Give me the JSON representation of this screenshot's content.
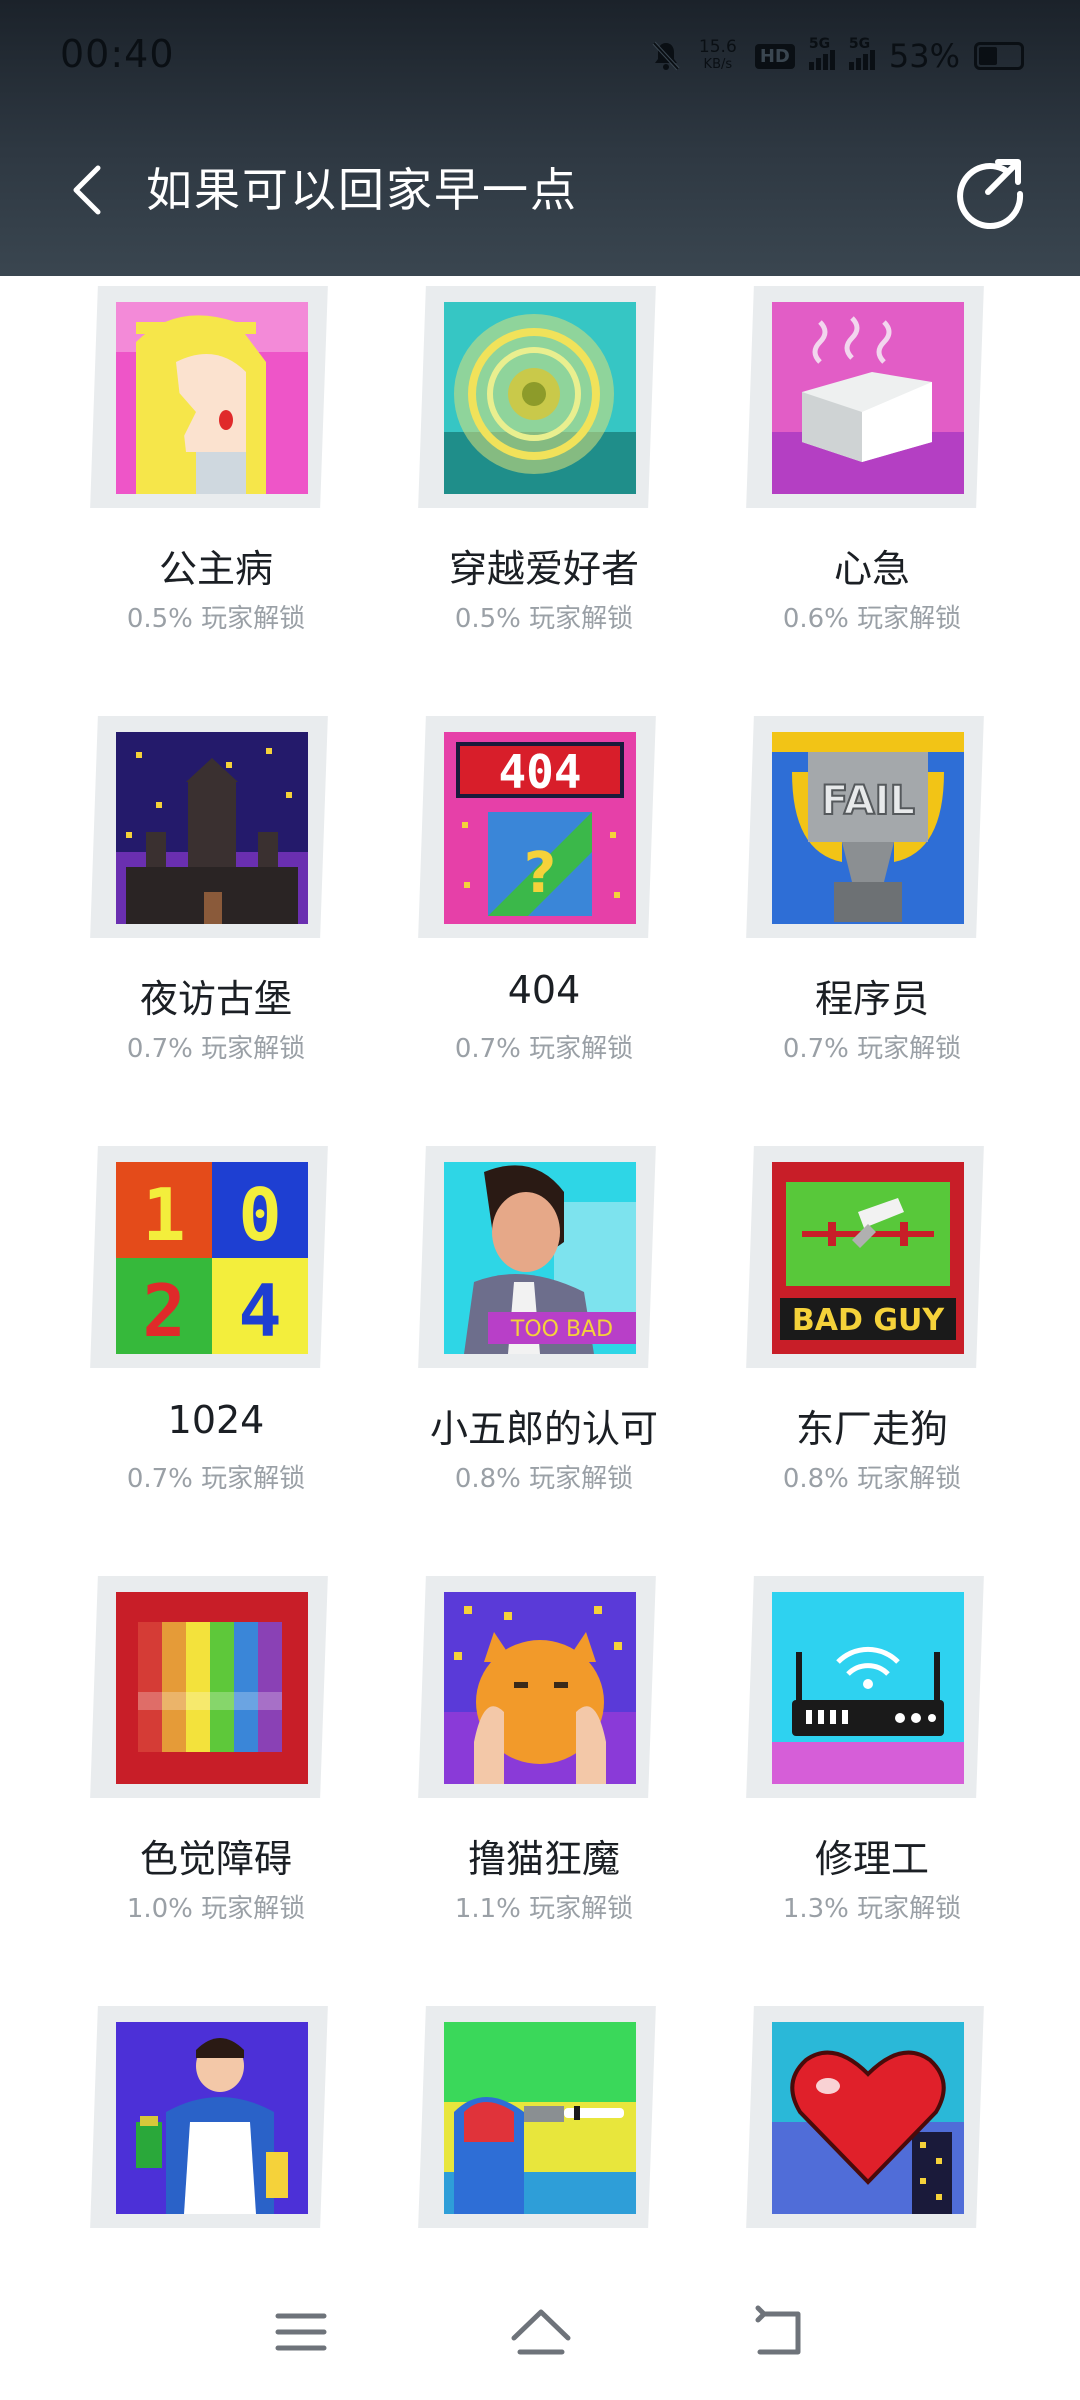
{
  "status": {
    "time": "00:40",
    "net_speed_value": "15.6",
    "net_speed_unit": "KB/s",
    "hd": "HD",
    "sim1": "5G",
    "sim2": "5G",
    "battery": "53%"
  },
  "header": {
    "title": "如果可以回家早一点",
    "back_icon": "chevron-left-icon",
    "share_icon": "share-icon"
  },
  "achievements": [
    {
      "name": "公主病",
      "rate": "0.5% 玩家解锁",
      "icon": "princess-icon"
    },
    {
      "name": "穿越爱好者",
      "rate": "0.5% 玩家解锁",
      "icon": "portal-icon"
    },
    {
      "name": "心急",
      "rate": "0.6% 玩家解锁",
      "icon": "tofu-icon"
    },
    {
      "name": "夜访古堡",
      "rate": "0.7% 玩家解锁",
      "icon": "castle-icon"
    },
    {
      "name": "404",
      "rate": "0.7% 玩家解锁",
      "icon": "404-icon",
      "tile_text": "404"
    },
    {
      "name": "程序员",
      "rate": "0.7% 玩家解锁",
      "icon": "fail-trophy-icon",
      "tile_text": "FAIL"
    },
    {
      "name": "1024",
      "rate": "0.7% 玩家解锁",
      "icon": "1024-icon",
      "tile_text": [
        "1",
        "0",
        "2",
        "4"
      ]
    },
    {
      "name": "小五郎的认可",
      "rate": "0.8% 玩家解锁",
      "icon": "too-bad-icon",
      "tile_text": "TOO BAD"
    },
    {
      "name": "东厂走狗",
      "rate": "0.8% 玩家解锁",
      "icon": "bad-guy-icon",
      "tile_text": "BAD GUY"
    },
    {
      "name": "色觉障碍",
      "rate": "1.0% 玩家解锁",
      "icon": "color-bars-icon"
    },
    {
      "name": "撸猫狂魔",
      "rate": "1.1% 玩家解锁",
      "icon": "cat-icon"
    },
    {
      "name": "修理工",
      "rate": "1.3% 玩家解锁",
      "icon": "router-icon"
    },
    {
      "name": "",
      "rate": "",
      "icon": "cleaner-icon"
    },
    {
      "name": "",
      "rate": "",
      "icon": "fan-icon"
    },
    {
      "name": "",
      "rate": "",
      "icon": "heart-icon"
    }
  ],
  "nav": {
    "menu_icon": "menu-icon",
    "home_icon": "home-icon",
    "back_icon": "back-icon"
  }
}
